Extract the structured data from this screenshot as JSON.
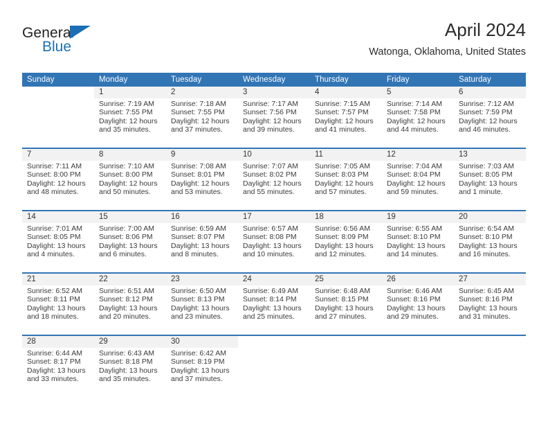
{
  "brand": {
    "name_top": "General",
    "name_bottom": "Blue",
    "triangle_color": "#1a6fb5",
    "text_color": "#231f20"
  },
  "header": {
    "title": "April 2024",
    "subtitle": "Watonga, Oklahoma, United States"
  },
  "theme": {
    "header_blue": "#3175b5",
    "daynum_band": "#f2f2f2",
    "text": "#3a3a3a"
  },
  "weekday_headers": [
    "Sunday",
    "Monday",
    "Tuesday",
    "Wednesday",
    "Thursday",
    "Friday",
    "Saturday"
  ],
  "labels": {
    "sunrise_prefix": "Sunrise:",
    "sunset_prefix": "Sunset:",
    "daylight_prefix": "Daylight:"
  },
  "weeks": [
    [
      {
        "day": "",
        "sunrise": "",
        "sunset": "",
        "daylight": ""
      },
      {
        "day": "1",
        "sunrise": "Sunrise: 7:19 AM",
        "sunset": "Sunset: 7:55 PM",
        "daylight": "Daylight: 12 hours and 35 minutes."
      },
      {
        "day": "2",
        "sunrise": "Sunrise: 7:18 AM",
        "sunset": "Sunset: 7:55 PM",
        "daylight": "Daylight: 12 hours and 37 minutes."
      },
      {
        "day": "3",
        "sunrise": "Sunrise: 7:17 AM",
        "sunset": "Sunset: 7:56 PM",
        "daylight": "Daylight: 12 hours and 39 minutes."
      },
      {
        "day": "4",
        "sunrise": "Sunrise: 7:15 AM",
        "sunset": "Sunset: 7:57 PM",
        "daylight": "Daylight: 12 hours and 41 minutes."
      },
      {
        "day": "5",
        "sunrise": "Sunrise: 7:14 AM",
        "sunset": "Sunset: 7:58 PM",
        "daylight": "Daylight: 12 hours and 44 minutes."
      },
      {
        "day": "6",
        "sunrise": "Sunrise: 7:12 AM",
        "sunset": "Sunset: 7:59 PM",
        "daylight": "Daylight: 12 hours and 46 minutes."
      }
    ],
    [
      {
        "day": "7",
        "sunrise": "Sunrise: 7:11 AM",
        "sunset": "Sunset: 8:00 PM",
        "daylight": "Daylight: 12 hours and 48 minutes."
      },
      {
        "day": "8",
        "sunrise": "Sunrise: 7:10 AM",
        "sunset": "Sunset: 8:00 PM",
        "daylight": "Daylight: 12 hours and 50 minutes."
      },
      {
        "day": "9",
        "sunrise": "Sunrise: 7:08 AM",
        "sunset": "Sunset: 8:01 PM",
        "daylight": "Daylight: 12 hours and 53 minutes."
      },
      {
        "day": "10",
        "sunrise": "Sunrise: 7:07 AM",
        "sunset": "Sunset: 8:02 PM",
        "daylight": "Daylight: 12 hours and 55 minutes."
      },
      {
        "day": "11",
        "sunrise": "Sunrise: 7:05 AM",
        "sunset": "Sunset: 8:03 PM",
        "daylight": "Daylight: 12 hours and 57 minutes."
      },
      {
        "day": "12",
        "sunrise": "Sunrise: 7:04 AM",
        "sunset": "Sunset: 8:04 PM",
        "daylight": "Daylight: 12 hours and 59 minutes."
      },
      {
        "day": "13",
        "sunrise": "Sunrise: 7:03 AM",
        "sunset": "Sunset: 8:05 PM",
        "daylight": "Daylight: 13 hours and 1 minute."
      }
    ],
    [
      {
        "day": "14",
        "sunrise": "Sunrise: 7:01 AM",
        "sunset": "Sunset: 8:05 PM",
        "daylight": "Daylight: 13 hours and 4 minutes."
      },
      {
        "day": "15",
        "sunrise": "Sunrise: 7:00 AM",
        "sunset": "Sunset: 8:06 PM",
        "daylight": "Daylight: 13 hours and 6 minutes."
      },
      {
        "day": "16",
        "sunrise": "Sunrise: 6:59 AM",
        "sunset": "Sunset: 8:07 PM",
        "daylight": "Daylight: 13 hours and 8 minutes."
      },
      {
        "day": "17",
        "sunrise": "Sunrise: 6:57 AM",
        "sunset": "Sunset: 8:08 PM",
        "daylight": "Daylight: 13 hours and 10 minutes."
      },
      {
        "day": "18",
        "sunrise": "Sunrise: 6:56 AM",
        "sunset": "Sunset: 8:09 PM",
        "daylight": "Daylight: 13 hours and 12 minutes."
      },
      {
        "day": "19",
        "sunrise": "Sunrise: 6:55 AM",
        "sunset": "Sunset: 8:10 PM",
        "daylight": "Daylight: 13 hours and 14 minutes."
      },
      {
        "day": "20",
        "sunrise": "Sunrise: 6:54 AM",
        "sunset": "Sunset: 8:10 PM",
        "daylight": "Daylight: 13 hours and 16 minutes."
      }
    ],
    [
      {
        "day": "21",
        "sunrise": "Sunrise: 6:52 AM",
        "sunset": "Sunset: 8:11 PM",
        "daylight": "Daylight: 13 hours and 18 minutes."
      },
      {
        "day": "22",
        "sunrise": "Sunrise: 6:51 AM",
        "sunset": "Sunset: 8:12 PM",
        "daylight": "Daylight: 13 hours and 20 minutes."
      },
      {
        "day": "23",
        "sunrise": "Sunrise: 6:50 AM",
        "sunset": "Sunset: 8:13 PM",
        "daylight": "Daylight: 13 hours and 23 minutes."
      },
      {
        "day": "24",
        "sunrise": "Sunrise: 6:49 AM",
        "sunset": "Sunset: 8:14 PM",
        "daylight": "Daylight: 13 hours and 25 minutes."
      },
      {
        "day": "25",
        "sunrise": "Sunrise: 6:48 AM",
        "sunset": "Sunset: 8:15 PM",
        "daylight": "Daylight: 13 hours and 27 minutes."
      },
      {
        "day": "26",
        "sunrise": "Sunrise: 6:46 AM",
        "sunset": "Sunset: 8:16 PM",
        "daylight": "Daylight: 13 hours and 29 minutes."
      },
      {
        "day": "27",
        "sunrise": "Sunrise: 6:45 AM",
        "sunset": "Sunset: 8:16 PM",
        "daylight": "Daylight: 13 hours and 31 minutes."
      }
    ],
    [
      {
        "day": "28",
        "sunrise": "Sunrise: 6:44 AM",
        "sunset": "Sunset: 8:17 PM",
        "daylight": "Daylight: 13 hours and 33 minutes."
      },
      {
        "day": "29",
        "sunrise": "Sunrise: 6:43 AM",
        "sunset": "Sunset: 8:18 PM",
        "daylight": "Daylight: 13 hours and 35 minutes."
      },
      {
        "day": "30",
        "sunrise": "Sunrise: 6:42 AM",
        "sunset": "Sunset: 8:19 PM",
        "daylight": "Daylight: 13 hours and 37 minutes."
      },
      {
        "day": "",
        "sunrise": "",
        "sunset": "",
        "daylight": ""
      },
      {
        "day": "",
        "sunrise": "",
        "sunset": "",
        "daylight": ""
      },
      {
        "day": "",
        "sunrise": "",
        "sunset": "",
        "daylight": ""
      },
      {
        "day": "",
        "sunrise": "",
        "sunset": "",
        "daylight": ""
      }
    ]
  ]
}
